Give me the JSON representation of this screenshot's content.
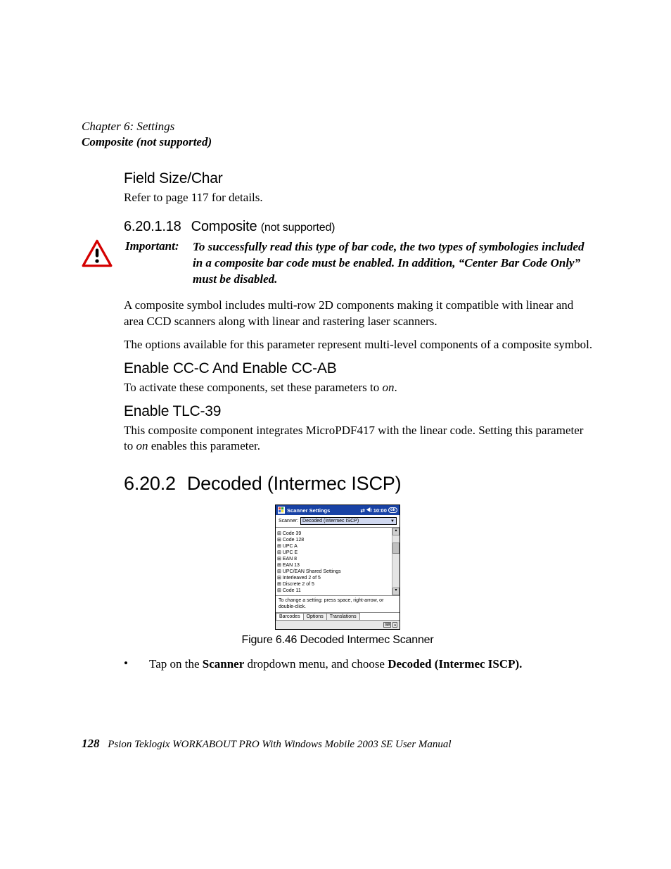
{
  "header": {
    "chapter": "Chapter 6: Settings",
    "subtitle": "Composite (not supported)"
  },
  "sec1": {
    "h": "Field Size/Char",
    "p": "Refer to page 117 for details."
  },
  "sec2": {
    "num": "6.20.1.18",
    "title": "Composite",
    "note": "(not supported)"
  },
  "important": {
    "label": "Important:",
    "text": "To successfully read this type of bar code, the two types of symbologies included in a composite bar code must be enabled. In addition, “Center Bar Code Only” must be disabled."
  },
  "para1": "A composite symbol includes multi-row 2D components making it compatible with linear and area CCD scanners along with linear and rastering laser scanners.",
  "para2": "The options available for this parameter represent multi-level components of a composite symbol.",
  "sec3": {
    "h": "Enable CC-C And Enable CC-AB",
    "p_pre": "To activate these components, set these parameters to ",
    "p_em": "on",
    "p_post": "."
  },
  "sec4": {
    "h": "Enable TLC-39",
    "p_pre": "This composite component integrates MicroPDF417 with the linear code. Setting this parameter to ",
    "p_em": "on",
    "p_post": " enables this parameter."
  },
  "sec5": {
    "num": "6.20.2",
    "title": "Decoded (Intermec ISCP)"
  },
  "shot": {
    "title": "Scanner Settings",
    "time": "10:00",
    "ok": "ok",
    "scanner_label": "Scanner:",
    "scanner_value": "Decoded (Intermec ISCP)",
    "items": [
      "Code 39",
      "Code 128",
      "UPC A",
      "UPC E",
      "EAN 8",
      "EAN 13",
      "UPC/EAN Shared Settings",
      "Interleaved 2 of 5",
      "Discrete 2 of 5",
      "Code 11"
    ],
    "hint": "To change a setting: press space, right-arrow, or double-click.",
    "tabs": [
      "Barcodes",
      "Options",
      "Translations"
    ]
  },
  "figcap": "Figure 6.46 Decoded Intermec Scanner",
  "bullet": {
    "pre": "Tap on the ",
    "b1": "Scanner",
    "mid": " dropdown menu, and choose ",
    "b2": "Decoded (Intermec ISCP)."
  },
  "footer": {
    "page": "128",
    "text": "Psion Teklogix WORKABOUT PRO With Windows Mobile 2003 SE User Manual"
  }
}
